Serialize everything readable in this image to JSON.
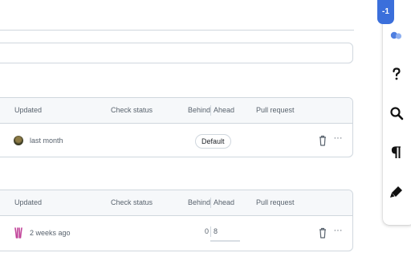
{
  "panel_1": {
    "headers": {
      "updated": "Updated",
      "check_status": "Check status",
      "behind": "Behind",
      "ahead": "Ahead",
      "pull_request": "Pull request"
    },
    "row": {
      "updated": "last month",
      "badge": "Default"
    }
  },
  "panel_2": {
    "headers": {
      "updated": "Updated",
      "check_status": "Check status",
      "behind": "Behind",
      "ahead": "Ahead",
      "pull_request": "Pull request"
    },
    "row": {
      "updated": "2 weeks ago",
      "behind": "0",
      "ahead": "8"
    }
  },
  "side_toolbar": {
    "badge": "-1",
    "icons": [
      "team-icon",
      "help-icon",
      "search-icon",
      "pilcrow-icon",
      "highlighter-icon"
    ]
  },
  "actions": {
    "more": "···"
  },
  "colors": {
    "accent": "#3b6fdb",
    "border": "#d0d7de",
    "header_bg": "#f6f8fa",
    "muted_text": "#59636e"
  }
}
